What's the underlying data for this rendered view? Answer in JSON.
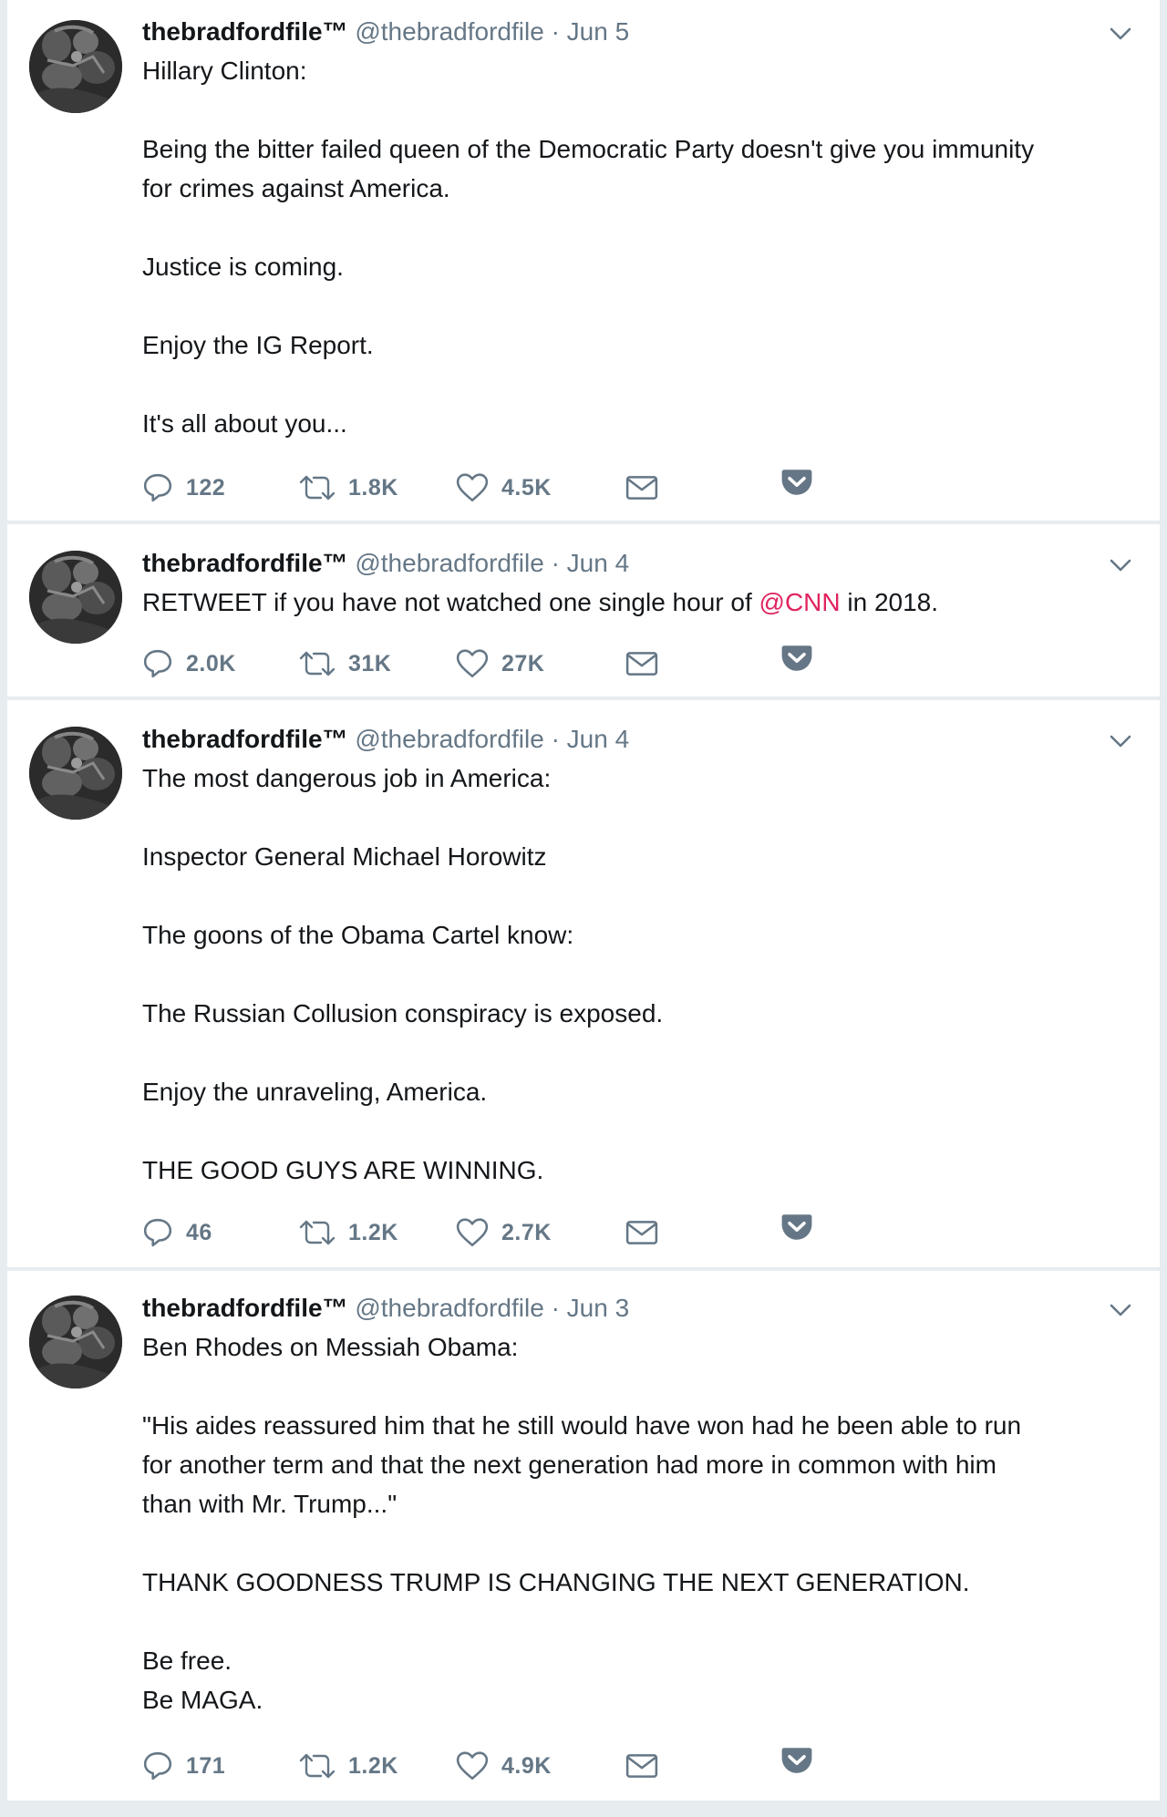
{
  "tweets": [
    {
      "fullname": "thebradfordfile™",
      "handle": "@thebradfordfile",
      "separator": "·",
      "date": "Jun 5",
      "lines": [
        "Hillary Clinton:",
        "",
        "Being the bitter failed queen of the Democratic Party doesn't give you immunity",
        "for crimes against America.",
        "",
        "Justice is coming.",
        "",
        "Enjoy the IG Report.",
        "",
        "It's all about you..."
      ],
      "replies": "122",
      "retweets": "1.8K",
      "likes": "4.5K"
    },
    {
      "fullname": "thebradfordfile™",
      "handle": "@thebradfordfile",
      "separator": "·",
      "date": "Jun 4",
      "text_before": "RETWEET if you have not watched one single hour of ",
      "mention": "@CNN",
      "text_after": " in 2018.",
      "replies": "2.0K",
      "retweets": "31K",
      "likes": "27K"
    },
    {
      "fullname": "thebradfordfile™",
      "handle": "@thebradfordfile",
      "separator": "·",
      "date": "Jun 4",
      "lines": [
        "The most dangerous job in America:",
        "",
        "Inspector General Michael Horowitz",
        "",
        "The goons of the Obama Cartel know:",
        "",
        "The Russian Collusion conspiracy is exposed.",
        "",
        "Enjoy the unraveling, America.",
        "",
        "THE GOOD GUYS ARE WINNING."
      ],
      "replies": "46",
      "retweets": "1.2K",
      "likes": "2.7K"
    },
    {
      "fullname": "thebradfordfile™",
      "handle": "@thebradfordfile",
      "separator": "·",
      "date": "Jun 3",
      "lines": [
        "Ben Rhodes on Messiah Obama:",
        "",
        "\"His aides reassured him that he still would have won had he been able to run",
        "for another term and that the next generation had more in common with him",
        "than with Mr. Trump...\"",
        "",
        "THANK GOODNESS TRUMP IS CHANGING THE NEXT GENERATION.",
        "",
        "Be free.",
        "Be MAGA."
      ],
      "replies": "171",
      "retweets": "1.2K",
      "likes": "4.9K"
    }
  ],
  "icons": {
    "reply": "speech-bubble-icon",
    "retweet": "retweet-arrows-icon",
    "like": "heart-outline-icon",
    "dm": "envelope-icon",
    "save": "pocket-save-icon",
    "menu": "chevron-down-icon"
  },
  "colors": {
    "background": "#e6ecf0",
    "card": "#ffffff",
    "text": "#14171a",
    "muted": "#657786",
    "mention": "#e0245e"
  }
}
